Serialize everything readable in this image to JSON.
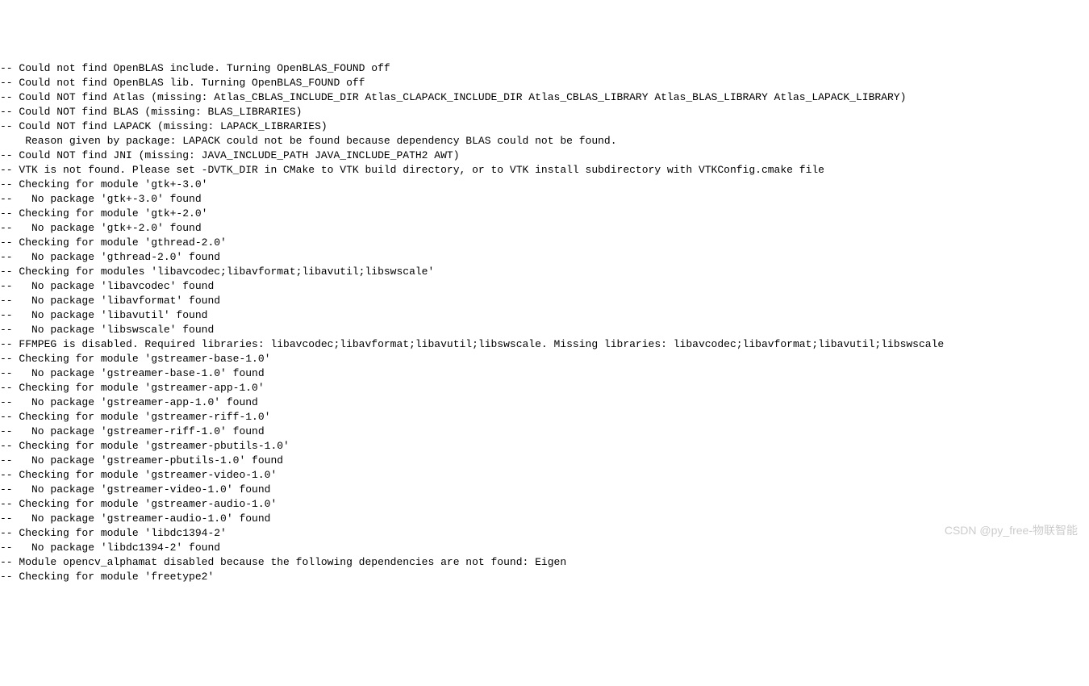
{
  "terminal": {
    "lines": [
      "-- Could not find OpenBLAS include. Turning OpenBLAS_FOUND off",
      "-- Could not find OpenBLAS lib. Turning OpenBLAS_FOUND off",
      "-- Could NOT find Atlas (missing: Atlas_CBLAS_INCLUDE_DIR Atlas_CLAPACK_INCLUDE_DIR Atlas_CBLAS_LIBRARY Atlas_BLAS_LIBRARY Atlas_LAPACK_LIBRARY)",
      "-- Could NOT find BLAS (missing: BLAS_LIBRARIES)",
      "-- Could NOT find LAPACK (missing: LAPACK_LIBRARIES)",
      "    Reason given by package: LAPACK could not be found because dependency BLAS could not be found.",
      "",
      "-- Could NOT find JNI (missing: JAVA_INCLUDE_PATH JAVA_INCLUDE_PATH2 AWT)",
      "-- VTK is not found. Please set -DVTK_DIR in CMake to VTK build directory, or to VTK install subdirectory with VTKConfig.cmake file",
      "-- Checking for module 'gtk+-3.0'",
      "--   No package 'gtk+-3.0' found",
      "-- Checking for module 'gtk+-2.0'",
      "--   No package 'gtk+-2.0' found",
      "-- Checking for module 'gthread-2.0'",
      "--   No package 'gthread-2.0' found",
      "-- Checking for modules 'libavcodec;libavformat;libavutil;libswscale'",
      "--   No package 'libavcodec' found",
      "--   No package 'libavformat' found",
      "--   No package 'libavutil' found",
      "--   No package 'libswscale' found",
      "-- FFMPEG is disabled. Required libraries: libavcodec;libavformat;libavutil;libswscale. Missing libraries: libavcodec;libavformat;libavutil;libswscale",
      "-- Checking for module 'gstreamer-base-1.0'",
      "--   No package 'gstreamer-base-1.0' found",
      "-- Checking for module 'gstreamer-app-1.0'",
      "--   No package 'gstreamer-app-1.0' found",
      "-- Checking for module 'gstreamer-riff-1.0'",
      "--   No package 'gstreamer-riff-1.0' found",
      "-- Checking for module 'gstreamer-pbutils-1.0'",
      "--   No package 'gstreamer-pbutils-1.0' found",
      "-- Checking for module 'gstreamer-video-1.0'",
      "--   No package 'gstreamer-video-1.0' found",
      "-- Checking for module 'gstreamer-audio-1.0'",
      "--   No package 'gstreamer-audio-1.0' found",
      "-- Checking for module 'libdc1394-2'",
      "--   No package 'libdc1394-2' found",
      "-- Module opencv_alphamat disabled because the following dependencies are not found: Eigen",
      "-- Checking for module 'freetype2'"
    ]
  },
  "watermark": {
    "text": "CSDN @py_free-物联智能"
  }
}
